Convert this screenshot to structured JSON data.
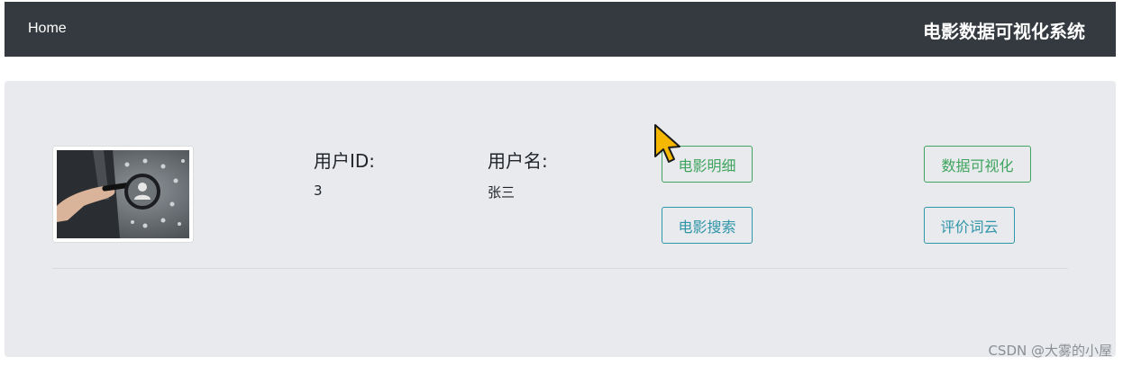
{
  "navbar": {
    "home_label": "Home",
    "title": "电影数据可视化系统"
  },
  "profile": {
    "user_id_label": "用户ID:",
    "user_id_value": "3",
    "username_label": "用户名:",
    "username_value": "张三"
  },
  "actions": {
    "movie_detail": "电影明细",
    "movie_search": "电影搜索",
    "data_visualization": "数据可视化",
    "review_wordcloud": "评价词云"
  },
  "watermark": "CSDN @大雾的小屋",
  "colors": {
    "navbar_bg": "#343a40",
    "panel_bg": "#e8eaed",
    "success": "#3fa45e",
    "info": "#2f95a8"
  }
}
